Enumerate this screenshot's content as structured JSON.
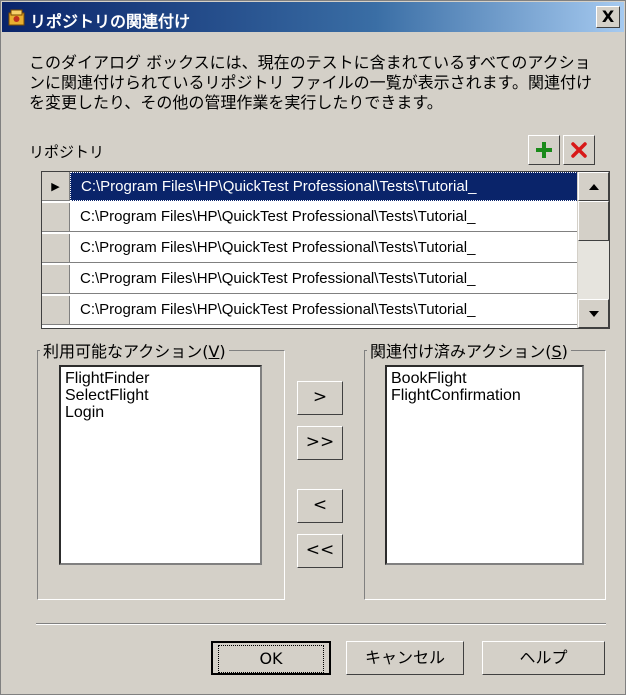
{
  "window": {
    "title": "リポジトリの関連付け",
    "close_label": "X"
  },
  "description": "このダイアログ ボックスには、現在のテストに含まれているすべてのアクションに関連付けられているリポジトリ ファイルの一覧が表示されます。関連付けを変更したり、その他の管理作業を実行したりできます。",
  "repository": {
    "label": "リポジトリ",
    "add_icon": "plus-icon",
    "remove_icon": "delete-icon",
    "add_color": "#1a8a1a",
    "remove_color": "#d81818",
    "rows": [
      {
        "path": "C:\\Program Files\\HP\\QuickTest Professional\\Tests\\Tutorial_",
        "selected": true,
        "marker": "▶"
      },
      {
        "path": "C:\\Program Files\\HP\\QuickTest Professional\\Tests\\Tutorial_",
        "selected": false,
        "marker": ""
      },
      {
        "path": "C:\\Program Files\\HP\\QuickTest Professional\\Tests\\Tutorial_",
        "selected": false,
        "marker": ""
      },
      {
        "path": "C:\\Program Files\\HP\\QuickTest Professional\\Tests\\Tutorial_",
        "selected": false,
        "marker": ""
      },
      {
        "path": "C:\\Program Files\\HP\\QuickTest Professional\\Tests\\Tutorial_",
        "selected": false,
        "marker": ""
      }
    ]
  },
  "available": {
    "legend_prefix": "利用可能なアクション(",
    "legend_key": "V",
    "legend_suffix": ")",
    "items": [
      "FlightFinder",
      "SelectFlight",
      "Login"
    ]
  },
  "associated": {
    "legend_prefix": "関連付け済みアクション(",
    "legend_key": "S",
    "legend_suffix": ")",
    "items": [
      "BookFlight",
      "FlightConfirmation"
    ]
  },
  "move_buttons": {
    "add": ">",
    "add_all": ">>",
    "remove": "<",
    "remove_all": "<<"
  },
  "buttons": {
    "ok": "OK",
    "cancel": "キャンセル",
    "help": "ヘルプ"
  }
}
